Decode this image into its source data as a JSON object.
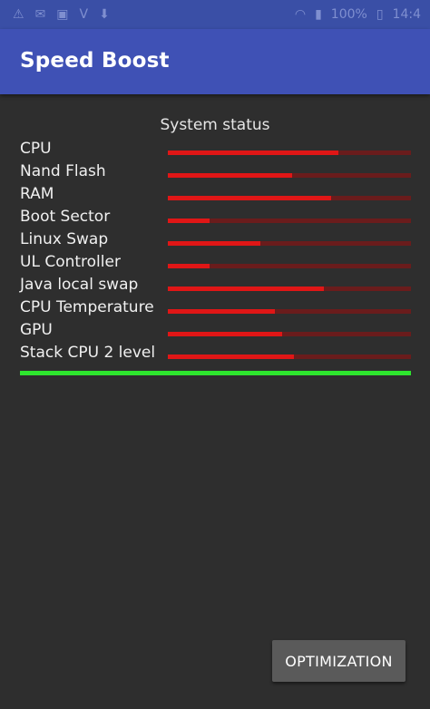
{
  "app": {
    "title": "Speed Boost"
  },
  "status_bar": {
    "battery": "100%",
    "time": "14:4"
  },
  "system_status": {
    "title": "System status",
    "items": [
      {
        "label": "CPU",
        "level": 0.7
      },
      {
        "label": "Nand Flash",
        "level": 0.51
      },
      {
        "label": "RAM",
        "level": 0.67
      },
      {
        "label": "Boot Sector",
        "level": 0.17
      },
      {
        "label": "Linux Swap",
        "level": 0.38
      },
      {
        "label": "UL Controller",
        "level": 0.17
      },
      {
        "label": "Java local swap",
        "level": 0.64
      },
      {
        "label": "CPU Temperature",
        "level": 0.44
      },
      {
        "label": "GPU",
        "level": 0.47
      },
      {
        "label": "Stack CPU 2 level",
        "level": 0.52
      }
    ],
    "overall_progress": 1.0
  },
  "colors": {
    "app_bar": "#3f51b5",
    "bar_fill": "#e01616",
    "bar_track": "#6a1c1c",
    "progress": "#2ee62e",
    "background": "#2e2e2e"
  },
  "actions": {
    "optimize_label": "OPTIMIZATION"
  }
}
